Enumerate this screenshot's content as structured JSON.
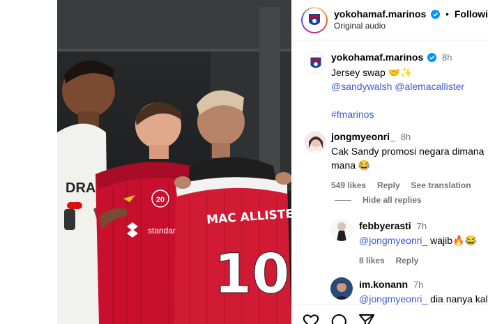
{
  "post": {
    "author": "yokohamaf.marinos",
    "separator": "•",
    "follow_label": "Following",
    "audio": "Original audio"
  },
  "caption": {
    "author": "yokohamaf.marinos",
    "time": "8h",
    "text": "Jersey swap 🤝✨",
    "mentions": "@sandywalsh @alemacallister",
    "hashtag": "#fmarinos"
  },
  "comments": [
    {
      "author": "jongmyeonri_",
      "time": "8h",
      "text": "Cak Sandy promosi negara dimana mana 😂",
      "likes": "549 likes",
      "reply_label": "Reply",
      "translate_label": "See translation"
    }
  ],
  "hide_replies": "Hide all replies",
  "replies": [
    {
      "author": "febbyerasti",
      "time": "7h",
      "mention": "@jongmyeonri_",
      "text": " wajib🔥😂",
      "likes": "8 likes",
      "reply_label": "Reply"
    },
    {
      "author": "im.konann",
      "time": "7h",
      "mention": "@jongmyeonri_",
      "text": " dia nanya kalo"
    }
  ],
  "photo": {
    "jersey_name": "MAC ALLISTER",
    "jersey_number": "10",
    "sponsor": "standard chartered",
    "badge": "20",
    "left_shirt_text": "DRAF"
  },
  "colors": {
    "link": "#3b5bdb",
    "verified": "#0095f6",
    "liverpool_red": "#c8102e"
  }
}
